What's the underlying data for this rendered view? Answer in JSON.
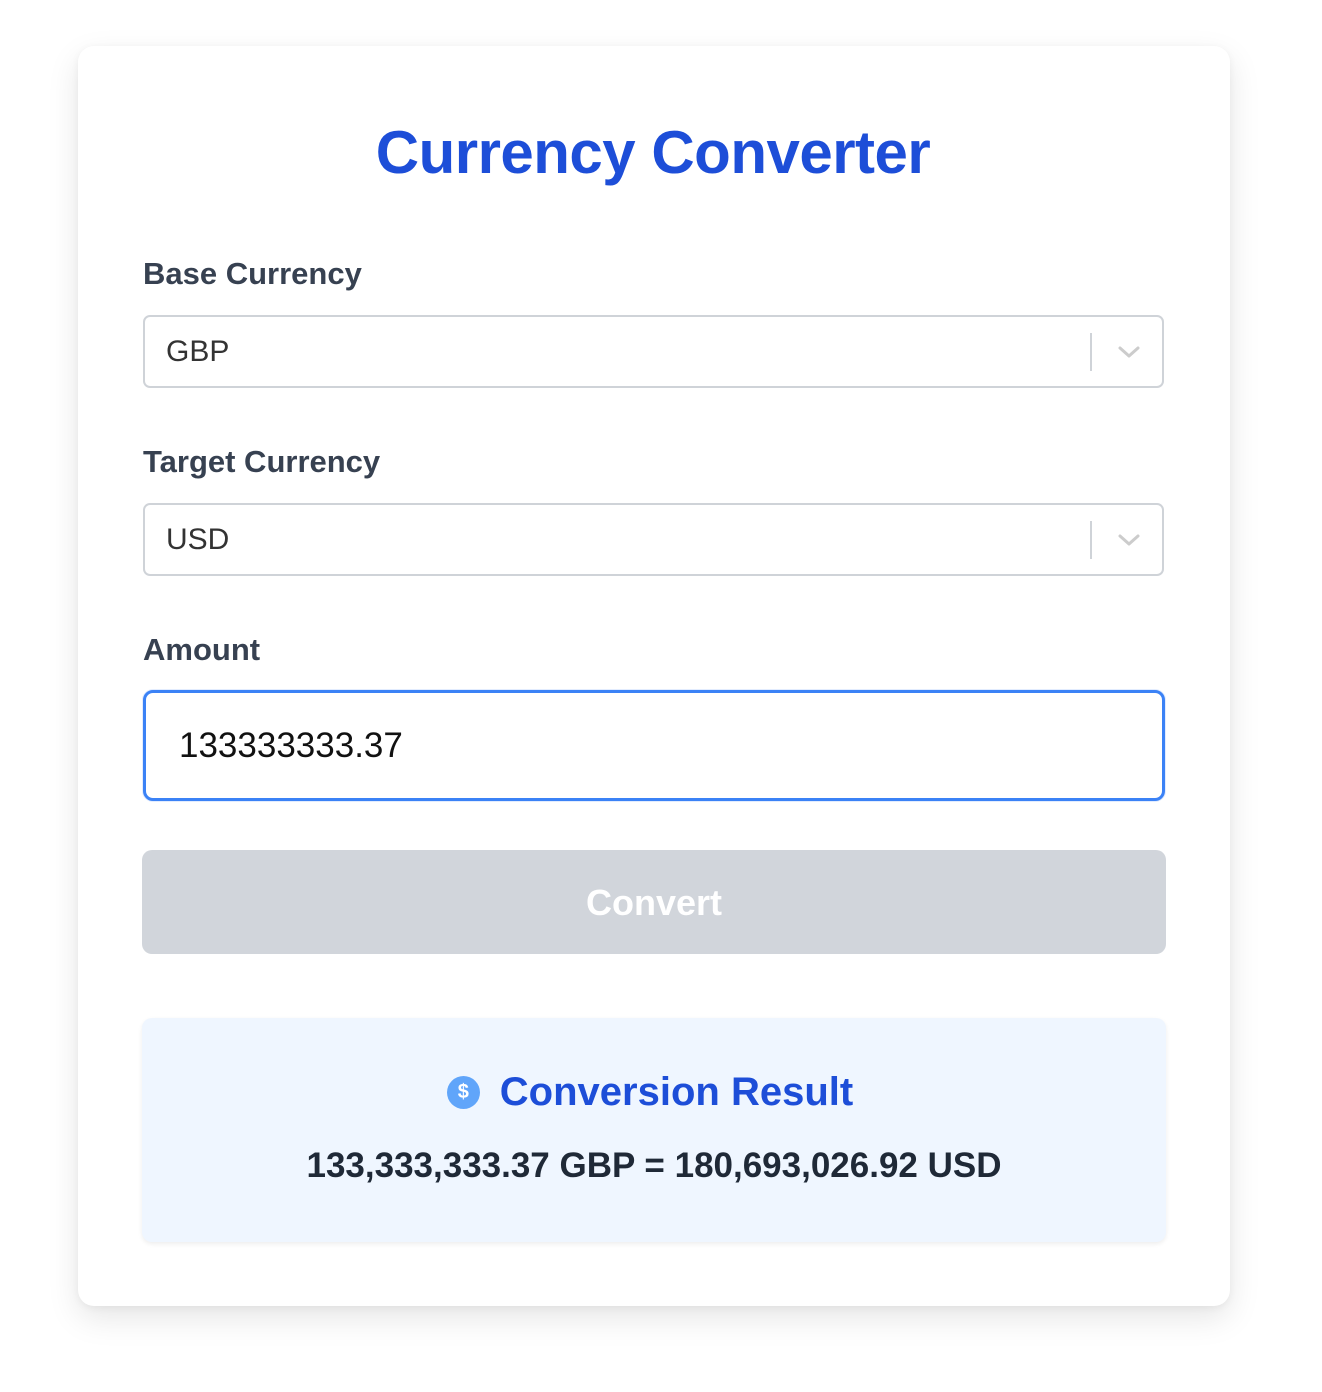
{
  "app": {
    "title": "Currency Converter"
  },
  "form": {
    "base_label": "Base Currency",
    "base_value": "GBP",
    "target_label": "Target Currency",
    "target_value": "USD",
    "amount_label": "Amount",
    "amount_value": "133333333.37",
    "convert_label": "Convert",
    "convert_disabled": true
  },
  "result": {
    "icon": "dollar-icon",
    "icon_glyph": "$",
    "title": "Conversion Result",
    "text": "133,333,333.37 GBP = 180,693,026.92 USD"
  },
  "colors": {
    "accent": "#1d4ed8",
    "focus_border": "#3b82f6",
    "button_disabled": "#d1d5db",
    "result_bg": "#eff6ff"
  }
}
